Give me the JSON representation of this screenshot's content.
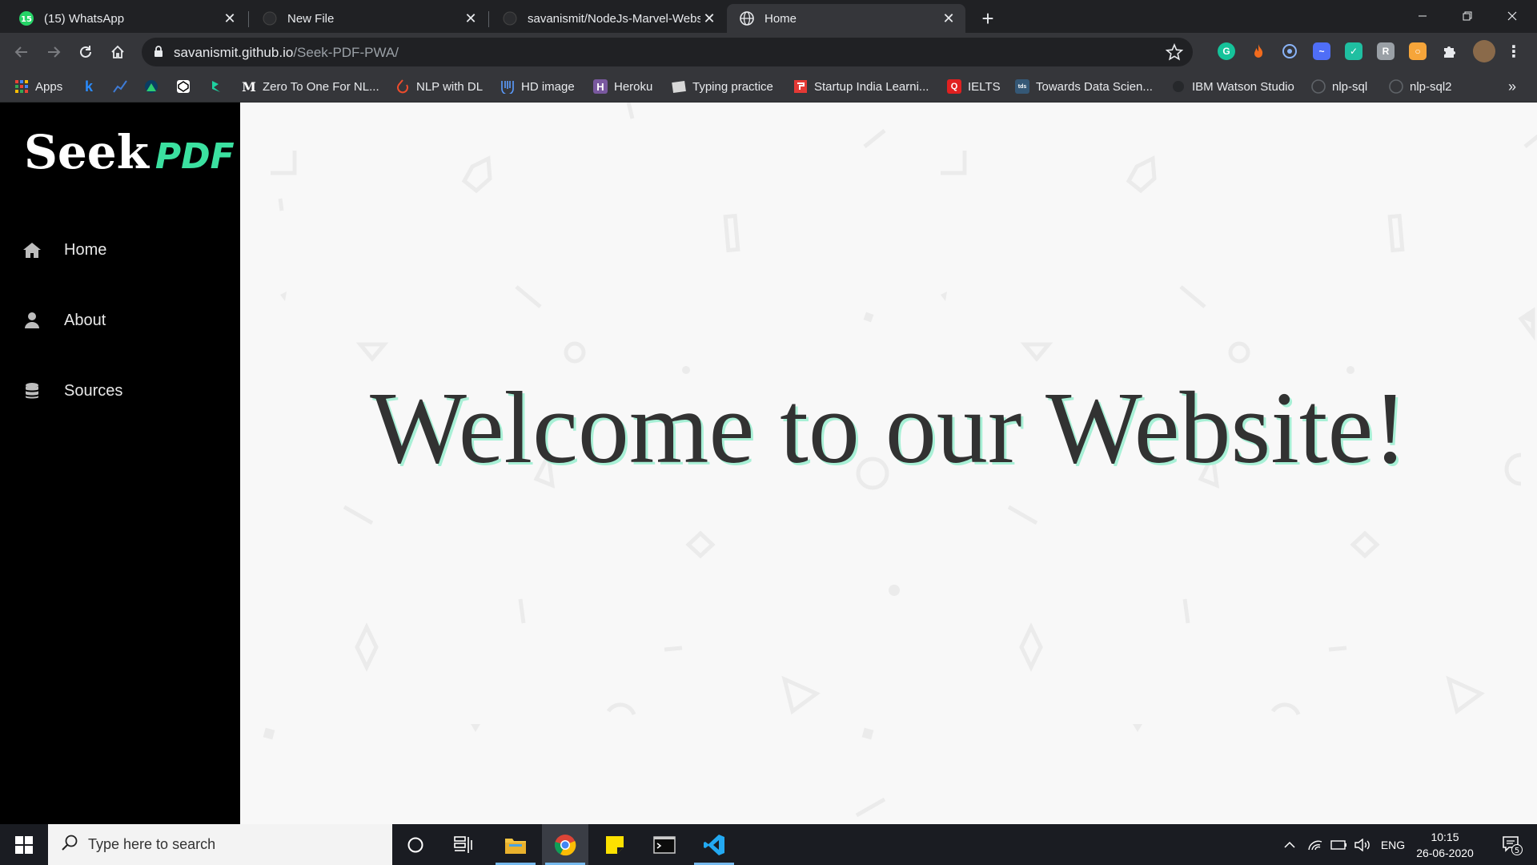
{
  "browser": {
    "tabs": [
      {
        "title": "(15) WhatsApp",
        "badge": "15",
        "icon": "whatsapp-icon",
        "active": false
      },
      {
        "title": "New File",
        "icon": "github-icon",
        "active": false
      },
      {
        "title": "savanismit/NodeJs-Marvel-Webs",
        "icon": "github-icon",
        "active": false
      },
      {
        "title": "Home",
        "icon": "globe-icon",
        "active": true
      }
    ],
    "url_host": "savanismit.github.io",
    "url_path": "/Seek-PDF-PWA/",
    "bookmarks": [
      {
        "label": "Apps",
        "icon": "apps-grid-icon"
      },
      {
        "label": "",
        "icon": "k-icon"
      },
      {
        "label": "",
        "icon": "chart-line-icon"
      },
      {
        "label": "",
        "icon": "arch-icon"
      },
      {
        "label": "",
        "icon": "codepen-icon"
      },
      {
        "label": "",
        "icon": "leaf-icon"
      },
      {
        "label": "Zero To One For NL...",
        "icon": "medium-icon"
      },
      {
        "label": "NLP with DL",
        "icon": "pytorch-icon"
      },
      {
        "label": "HD image",
        "icon": "unsplash-icon"
      },
      {
        "label": "Heroku",
        "icon": "heroku-icon"
      },
      {
        "label": "Typing practice",
        "icon": "keyboard-icon"
      },
      {
        "label": "Startup India Learni...",
        "icon": "startup-icon"
      },
      {
        "label": "IELTS",
        "icon": "ielts-icon"
      },
      {
        "label": "Towards Data Scien...",
        "icon": "tds-icon"
      },
      {
        "label": "IBM Watson Studio",
        "icon": "ibm-icon"
      },
      {
        "label": "nlp-sql",
        "icon": "github-icon"
      },
      {
        "label": "nlp-sql2",
        "icon": "github-icon"
      }
    ],
    "bookmark_text": {
      "apps_letter": "",
      "k_letter": "k",
      "medium_letter": "M",
      "heroku_letter": "H",
      "tds_letter": "tds",
      "ielts_letter": "Q"
    },
    "more_bookmarks": "»"
  },
  "site": {
    "logo_word": "Seek",
    "logo_accent": "PDF",
    "nav": [
      {
        "label": "Home",
        "icon": "home-icon"
      },
      {
        "label": "About",
        "icon": "user-icon"
      },
      {
        "label": "Sources",
        "icon": "database-icon"
      }
    ],
    "headline": "Welcome to our Website!"
  },
  "taskbar": {
    "search_placeholder": "Type here to search",
    "language": "ENG",
    "time": "10:15",
    "date": "26-06-2020",
    "notification_count": "5"
  },
  "colors": {
    "accent_green": "#3be0a0",
    "sidebar_bg": "#000000",
    "page_bg": "#f8f8f8"
  }
}
